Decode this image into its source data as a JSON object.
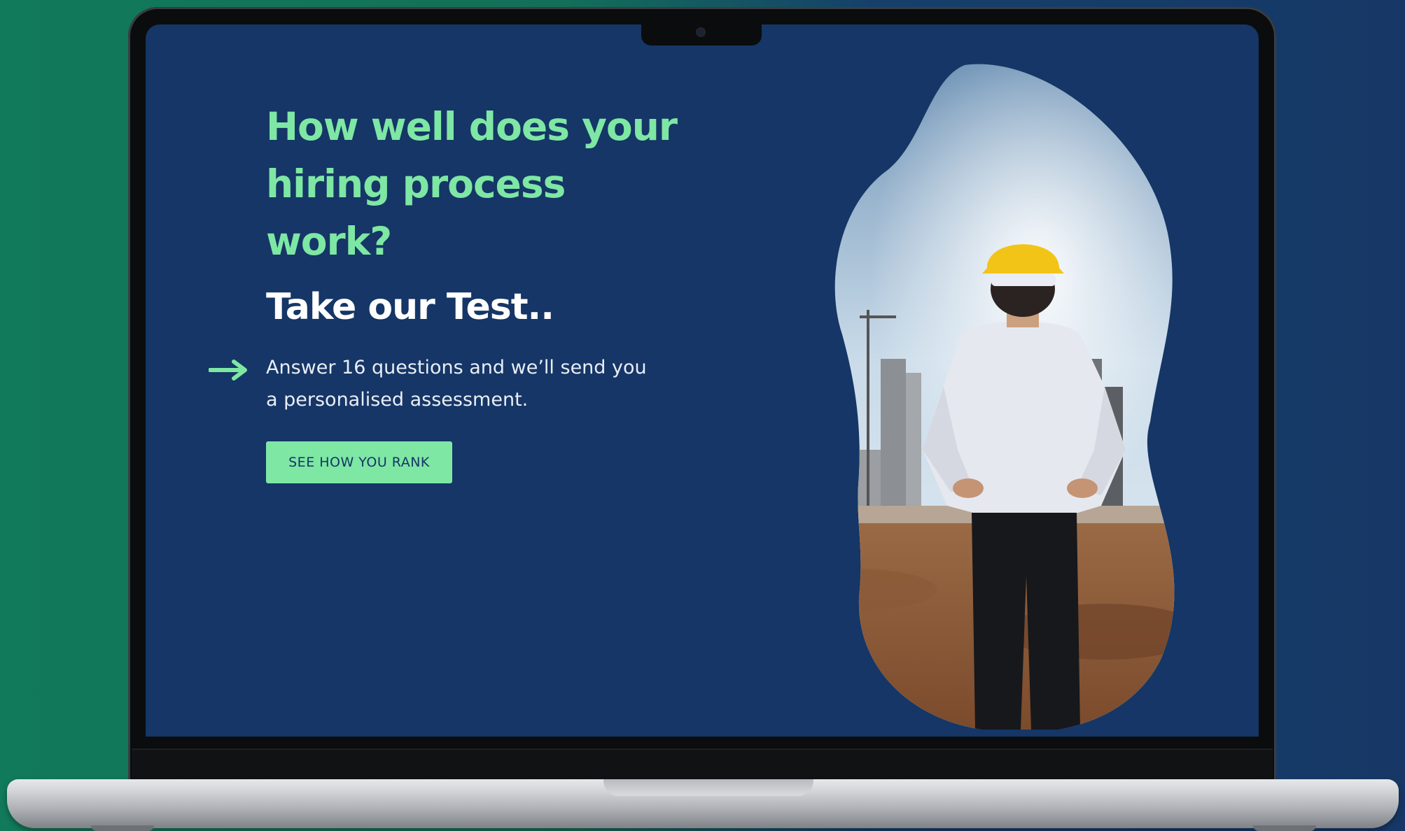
{
  "hero": {
    "headline": "How well does your hiring process work?",
    "subheadline": "Take our Test..",
    "description": "Answer 16 questions and we’ll send you a personalised assessment.",
    "cta_label": "SEE HOW YOU RANK"
  },
  "image": {
    "description": "Construction worker in yellow hard hat viewed from behind, overlooking a building site"
  },
  "icons": {
    "arrow": "arrow-right-icon"
  },
  "colors": {
    "background": "#153666",
    "accent": "#7ee7a4",
    "text": "#ffffff"
  }
}
